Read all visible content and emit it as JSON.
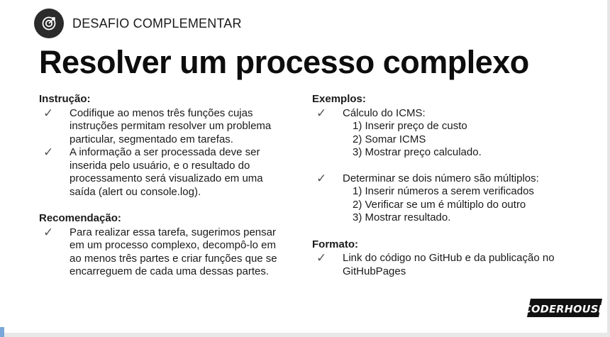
{
  "header": {
    "label": "DESAFIO COMPLEMENTAR",
    "icon": "target-icon"
  },
  "title": "Resolver um processo complexo",
  "instrucao": {
    "heading": "Instrução:",
    "items": [
      "Codifique ao menos três funções cujas instruções permitam resolver um problema particular, segmentado em tarefas.",
      "A informação a ser processada deve ser inserida pelo usuário, e o resultado do processamento será visualizado em uma saída (alert ou console.log)."
    ]
  },
  "recomendacao": {
    "heading": "Recomendação:",
    "items": [
      "Para realizar essa tarefa, sugerimos pensar em um processo complexo, decompô-lo em ao menos três partes e criar funções que se encarreguem de cada uma dessas partes."
    ]
  },
  "exemplos": {
    "heading": "Exemplos:",
    "groups": [
      {
        "label": "Cálculo do ICMS:",
        "steps": [
          "1) Inserir preço de custo",
          "2) Somar ICMS",
          "3) Mostrar preço calculado."
        ]
      },
      {
        "label": "Determinar se dois número são múltiplos:",
        "steps": [
          "1) Inserir números a serem verificados",
          "2) Verificar se um é múltiplo do outro",
          "3) Mostrar resultado."
        ]
      }
    ]
  },
  "formato": {
    "heading": "Formato:",
    "items": [
      "Link do código no GitHub e da publicação no GitHubPages"
    ]
  },
  "logo": {
    "text": "CODERHOUSE"
  },
  "check_glyph": "✓",
  "colors": {
    "badge": "#2b2b2b",
    "text": "#1a1a1a",
    "accent": "#7aa7d9"
  }
}
